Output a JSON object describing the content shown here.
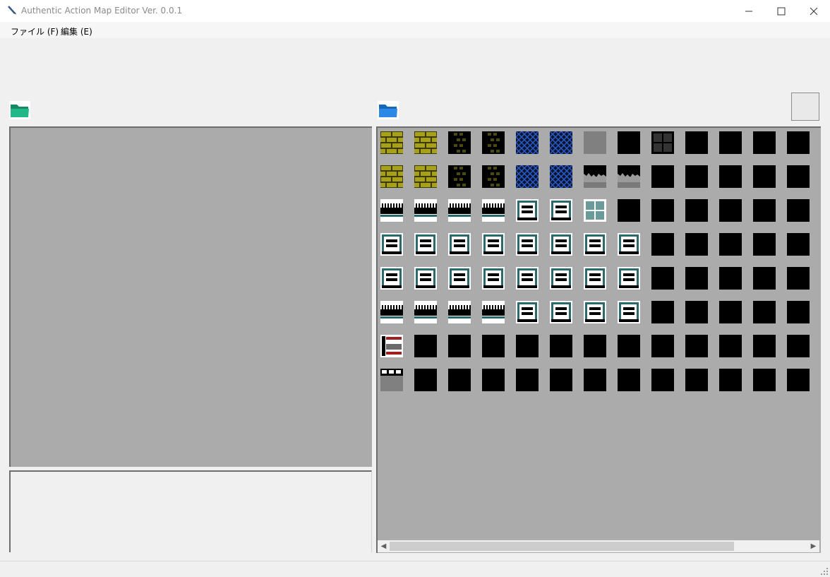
{
  "window": {
    "title": "Authentic Action Map Editor Ver. 0.0.1",
    "controls": [
      "minimize",
      "maximize",
      "close"
    ]
  },
  "menu": {
    "items": [
      {
        "label": "ファイル (F)"
      },
      {
        "label": "編集 (E)"
      }
    ]
  },
  "toolbar": {
    "map_folder_icon": "green-folder-icon",
    "tileset_folder_icon": "blue-folder-icon"
  },
  "colors": {
    "map_folder": "#1eaa7a",
    "tileset_folder": "#1e82dc",
    "panel_background": "#ababab"
  },
  "tileset": {
    "rows": [
      [
        "brick",
        "brick",
        "brick-dark",
        "brick-dark",
        "mesh",
        "mesh",
        "gray",
        "black",
        "black-grid",
        "black",
        "black",
        "black",
        "black"
      ],
      [
        "brick",
        "brick",
        "brick-dark",
        "brick-dark",
        "mesh",
        "mesh",
        "rubble",
        "rubble",
        "black",
        "black",
        "black",
        "black",
        "black"
      ],
      [
        "rail",
        "rail",
        "rail",
        "rail",
        "machine",
        "machine",
        "window",
        "black",
        "black",
        "black",
        "black",
        "black",
        "black"
      ],
      [
        "machine",
        "machine",
        "machine",
        "machine",
        "machine",
        "machine",
        "machine",
        "machine",
        "black",
        "black",
        "black",
        "black",
        "black"
      ],
      [
        "machine",
        "machine",
        "machine",
        "machine",
        "machine",
        "machine",
        "machine",
        "machine",
        "black",
        "black",
        "black",
        "black",
        "black"
      ],
      [
        "rail",
        "rail",
        "rail",
        "rail",
        "machine",
        "machine",
        "machine",
        "machine",
        "black",
        "black",
        "black",
        "black",
        "black"
      ],
      [
        "door",
        "black",
        "black",
        "black",
        "black",
        "black",
        "black",
        "black",
        "black",
        "black",
        "black",
        "black",
        "black"
      ],
      [
        "ledge",
        "black",
        "black",
        "black",
        "black",
        "black",
        "black",
        "black",
        "black",
        "black",
        "black",
        "black",
        "black"
      ]
    ]
  }
}
